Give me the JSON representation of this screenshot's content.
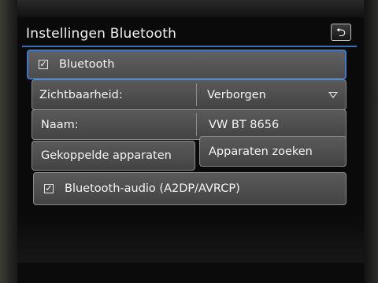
{
  "header": {
    "title": "Instellingen Bluetooth",
    "back_symbol": "⮌",
    "back_icon": "back-arrow-icon"
  },
  "settings": {
    "bluetooth": {
      "label": "Bluetooth",
      "checked": true
    },
    "visibility": {
      "label": "Zichtbaarheid:",
      "value": "Verborgen",
      "dropdown_icon": "dropdown-triangle-icon"
    },
    "name": {
      "label": "Naam:",
      "value": "VW BT 8656"
    },
    "paired_devices": {
      "label": "Gekoppelde apparaten"
    },
    "search_devices": {
      "label": "Apparaten zoeken"
    },
    "bluetooth_audio": {
      "label": "Bluetooth-audio (A2DP/AVRCP)",
      "checked": true
    }
  },
  "checkmark_symbol": "✓",
  "colors": {
    "accent": "#3d79c8",
    "button": "#4e4e4e",
    "text": "#f5f5f5",
    "background": "#0a0a0a"
  }
}
